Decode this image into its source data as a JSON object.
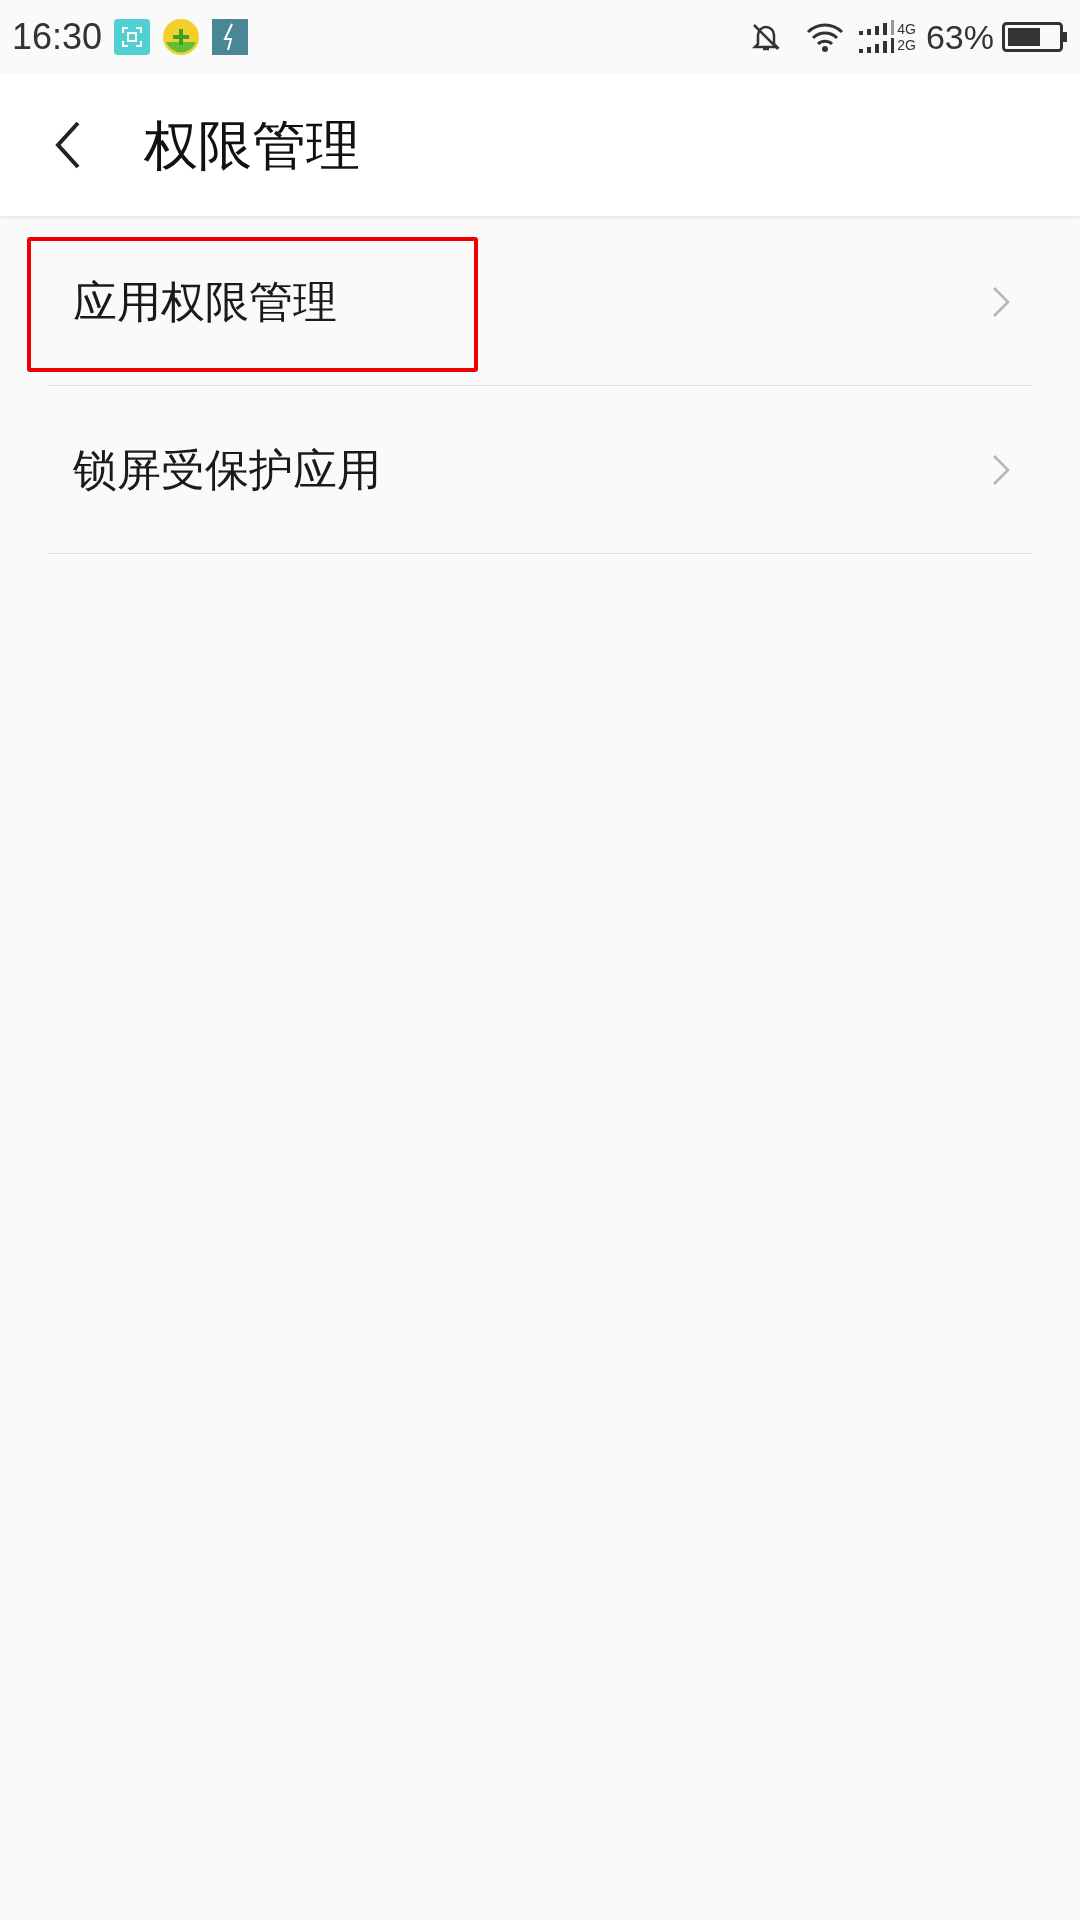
{
  "status_bar": {
    "time": "16:30",
    "network_top": "4G",
    "network_bottom": "2G",
    "battery": "63%"
  },
  "header": {
    "title": "权限管理"
  },
  "items": [
    {
      "label": "应用权限管理",
      "highlighted": true
    },
    {
      "label": "锁屏受保护应用",
      "highlighted": false
    }
  ]
}
